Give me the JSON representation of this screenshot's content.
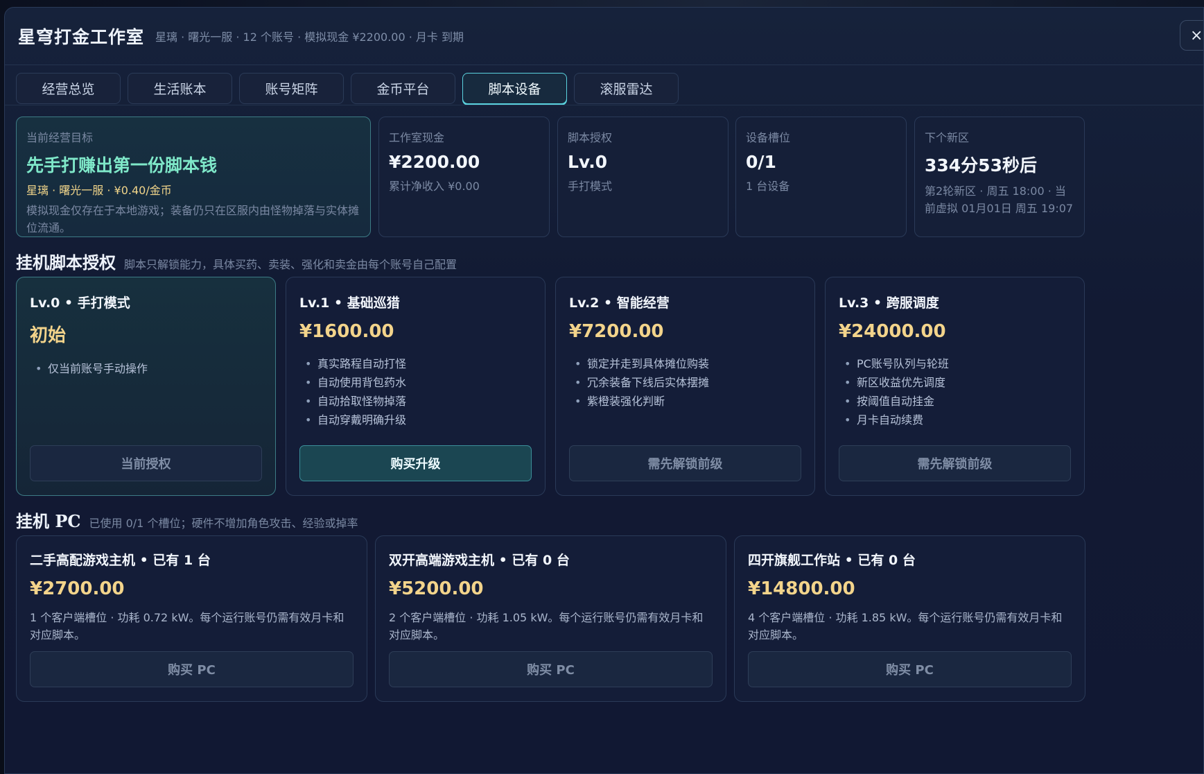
{
  "header": {
    "title": "星穹打金工作室",
    "subtitle": "星璃 · 曙光一服 · 12 个账号 · 模拟现金 ¥2200.00 · 月卡 到期",
    "close_label": "×"
  },
  "tabs": [
    {
      "label": "经营总览",
      "active": false
    },
    {
      "label": "生活账本",
      "active": false
    },
    {
      "label": "账号矩阵",
      "active": false
    },
    {
      "label": "金币平台",
      "active": false
    },
    {
      "label": "脚本设备",
      "active": true
    },
    {
      "label": "滚服雷达",
      "active": false
    }
  ],
  "goal": {
    "label": "当前经营目标",
    "title": "先手打赚出第一份脚本钱",
    "line": "星璃 · 曙光一服 · ¥0.40/金币",
    "desc": "模拟现金仅存在于本地游戏；装备仍只在区服内由怪物掉落与实体摊位流通。"
  },
  "stats": [
    {
      "label": "工作室现金",
      "value": "¥2200.00",
      "sub": "累计净收入 ¥0.00"
    },
    {
      "label": "脚本授权",
      "value": "Lv.0",
      "sub": "手打模式"
    },
    {
      "label": "设备槽位",
      "value": "0/1",
      "sub": "1 台设备"
    },
    {
      "label": "下个新区",
      "value": "334分53秒后",
      "sub": "第2轮新区 · 周五 18:00 · 当前虚拟 01月01日 周五 19:07"
    }
  ],
  "license_section": {
    "title": "挂机脚本授权",
    "desc": "脚本只解锁能力，具体买药、卖装、强化和卖金由每个账号自己配置"
  },
  "licenses": [
    {
      "name": "Lv.0 • 手打模式",
      "price": "初始",
      "features": [
        "仅当前账号手动操作"
      ],
      "button": "当前授权",
      "state": "current"
    },
    {
      "name": "Lv.1 • 基础巡猎",
      "price": "¥1600.00",
      "features": [
        "真实路程自动打怪",
        "自动使用背包药水",
        "自动拾取怪物掉落",
        "自动穿戴明确升级"
      ],
      "button": "购买升级",
      "state": "buy"
    },
    {
      "name": "Lv.2 • 智能经营",
      "price": "¥7200.00",
      "features": [
        "锁定并走到具体摊位购装",
        "冗余装备下线后实体摆摊",
        "紫橙装强化判断"
      ],
      "button": "需先解锁前级",
      "state": "locked"
    },
    {
      "name": "Lv.3 • 跨服调度",
      "price": "¥24000.00",
      "features": [
        "PC账号队列与轮班",
        "新区收益优先调度",
        "按阈值自动挂金",
        "月卡自动续费"
      ],
      "button": "需先解锁前级",
      "state": "locked"
    }
  ],
  "pc_section": {
    "title": "挂机 PC",
    "desc": "已使用 0/1 个槽位；硬件不增加角色攻击、经验或掉率"
  },
  "pcs": [
    {
      "name": "二手高配游戏主机 • 已有 1 台",
      "price": "¥2700.00",
      "desc": "1 个客户端槽位 · 功耗 0.72 kW。每个运行账号仍需有效月卡和对应脚本。",
      "button": "购买 PC"
    },
    {
      "name": "双开高端游戏主机 • 已有 0 台",
      "price": "¥5200.00",
      "desc": "2 个客户端槽位 · 功耗 1.05 kW。每个运行账号仍需有效月卡和对应脚本。",
      "button": "购买 PC"
    },
    {
      "name": "四开旗舰工作站 • 已有 0 台",
      "price": "¥14800.00",
      "desc": "4 个客户端槽位 · 功耗 1.85 kW。每个运行账号仍需有效月卡和对应脚本。",
      "button": "购买 PC"
    }
  ]
}
